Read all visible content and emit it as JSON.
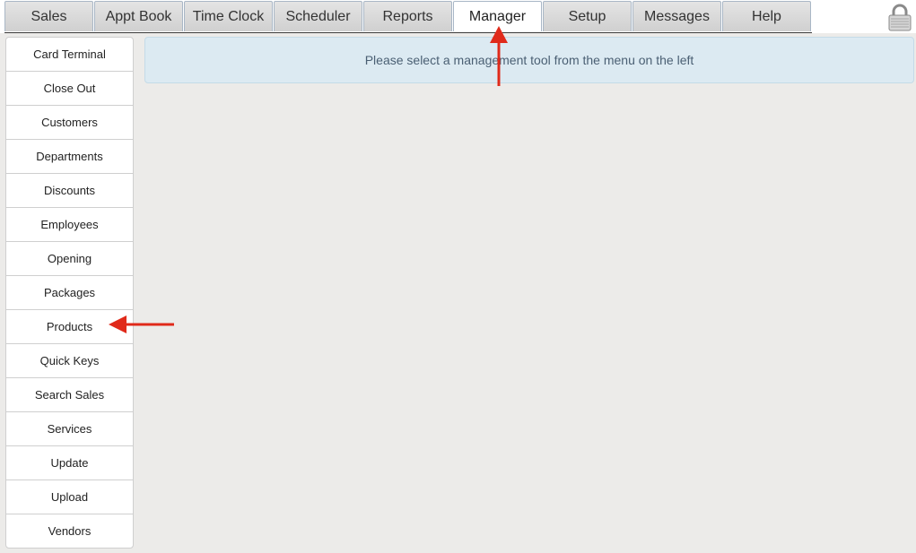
{
  "tabs": [
    {
      "label": "Sales"
    },
    {
      "label": "Appt Book"
    },
    {
      "label": "Time Clock"
    },
    {
      "label": "Scheduler"
    },
    {
      "label": "Reports"
    },
    {
      "label": "Manager",
      "active": true
    },
    {
      "label": "Setup"
    },
    {
      "label": "Messages"
    },
    {
      "label": "Help"
    }
  ],
  "sidebar": {
    "items": [
      {
        "label": "Card Terminal"
      },
      {
        "label": "Close Out"
      },
      {
        "label": "Customers"
      },
      {
        "label": "Departments"
      },
      {
        "label": "Discounts"
      },
      {
        "label": "Employees"
      },
      {
        "label": "Opening"
      },
      {
        "label": "Packages"
      },
      {
        "label": "Products"
      },
      {
        "label": "Quick Keys"
      },
      {
        "label": "Search Sales"
      },
      {
        "label": "Services"
      },
      {
        "label": "Update"
      },
      {
        "label": "Upload"
      },
      {
        "label": "Vendors"
      }
    ]
  },
  "main": {
    "message": "Please select a management tool from the menu on the left"
  },
  "icons": {
    "lock": "lock-icon"
  },
  "colors": {
    "annotation_arrow": "#e02a1a",
    "notice_background": "#dceaf2",
    "notice_text": "#4a5f73"
  }
}
